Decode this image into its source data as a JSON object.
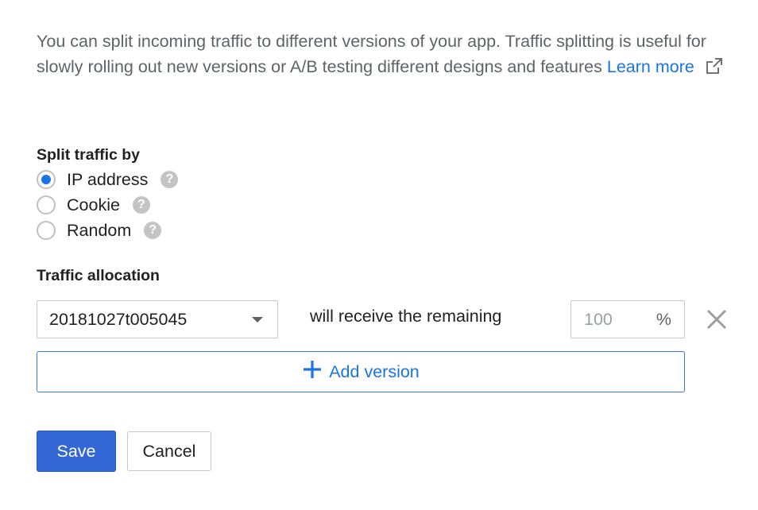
{
  "intro": {
    "text": "You can split incoming traffic to different versions of your app. Traffic splitting is useful for slowly rolling out new versions or A/B testing different designs and features ",
    "learn_more": "Learn more",
    "external_icon": "external-link-icon"
  },
  "split": {
    "title": "Split traffic by",
    "options": [
      {
        "label": "IP address",
        "selected": true
      },
      {
        "label": "Cookie",
        "selected": false
      },
      {
        "label": "Random",
        "selected": false
      }
    ],
    "help_icon": "help-icon",
    "help_glyph": "?"
  },
  "allocation": {
    "title": "Traffic allocation",
    "version": "20181027t005045",
    "remaining_label": "will receive the remaining",
    "percent_value": "100",
    "percent_sign": "%",
    "add_version_label": "Add version",
    "remove_icon": "close-icon",
    "add_icon": "plus-icon"
  },
  "actions": {
    "save": "Save",
    "cancel": "Cancel"
  },
  "colors": {
    "accent": "#1a73e8",
    "primary_button": "#3367d6",
    "help_icon_bg": "#c4c4c4"
  }
}
